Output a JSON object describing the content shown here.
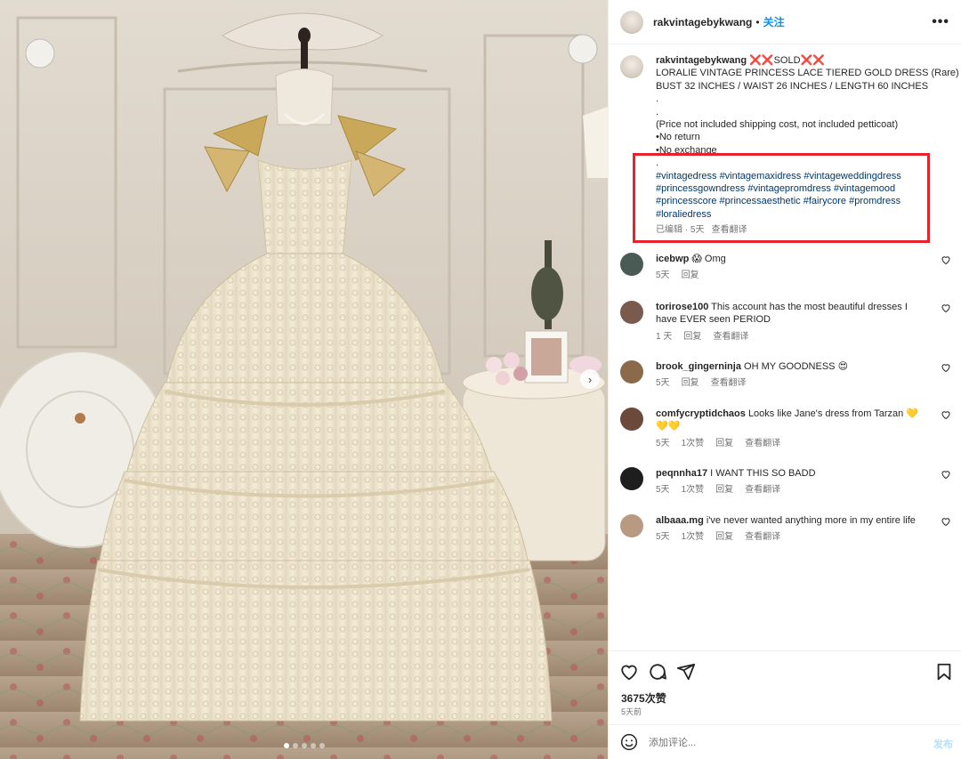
{
  "post": {
    "author": "rakvintagebykwang",
    "separator": "•",
    "follow_label": "关注",
    "more_label": "•••"
  },
  "caption": {
    "author": "rakvintagebykwang",
    "marker": "❌❌",
    "sold": "SOLD",
    "lines": [
      "LORALIE VINTAGE PRINCESS LACE TIERED GOLD DRESS (Rare)",
      "BUST 32 INCHES / WAIST 26 INCHES / LENGTH 60 INCHES",
      ".",
      ".",
      "(Price not included shipping cost, not included petticoat)",
      "•No return",
      "•No exchange",
      "."
    ],
    "hashtags": [
      "#vintagedress",
      "#vintagemaxidress",
      "#vintageweddingdress",
      "#princessgowndress",
      "#vintagepromdress",
      "#vintagemood",
      "#princesscore",
      "#princessaesthetic",
      "#fairycore",
      "#promdress",
      "#loraliedress"
    ],
    "edited": "已编辑 · 5天",
    "translate": "查看翻译"
  },
  "comments": [
    {
      "user": "icebwp",
      "text": "😱 Omg",
      "time": "5天",
      "actions": [
        "回复"
      ],
      "avatar_color": "#4a5a55"
    },
    {
      "user": "torirose100",
      "text": "This account has the most beautiful dresses I have EVER seen PERIOD",
      "time": "1 天",
      "actions": [
        "回复",
        "查看翻译"
      ],
      "avatar_color": "#7a5a4c"
    },
    {
      "user": "brook_gingerninja",
      "text": "OH MY GOODNESS 😍",
      "time": "5天",
      "actions": [
        "回复",
        "查看翻译"
      ],
      "avatar_color": "#8a6a4a"
    },
    {
      "user": "comfycryptidchaos",
      "text": "Looks like Jane's dress from Tarzan 💛💛💛",
      "time": "5天",
      "actions": [
        "1次赞",
        "回复",
        "查看翻译"
      ],
      "avatar_color": "#6b4a3c"
    },
    {
      "user": "peqnnha17",
      "text": "I WANT THIS SO BADD",
      "time": "5天",
      "actions": [
        "1次赞",
        "回复",
        "查看翻译"
      ],
      "avatar_color": "#1e1e1e"
    },
    {
      "user": "albaaa.mg",
      "text": "i've never wanted anything more in my entire life",
      "time": "5天",
      "actions": [
        "1次赞",
        "回复",
        "查看翻译"
      ],
      "avatar_color": "#b89a82"
    }
  ],
  "actions": {
    "likes": "3675次赞",
    "date": "5天前",
    "comment_placeholder": "添加评论...",
    "post_label": "发布"
  },
  "colors": {
    "accent": "#0095f6",
    "hashtag": "#00376b",
    "highlight_box": "#e8212b"
  }
}
